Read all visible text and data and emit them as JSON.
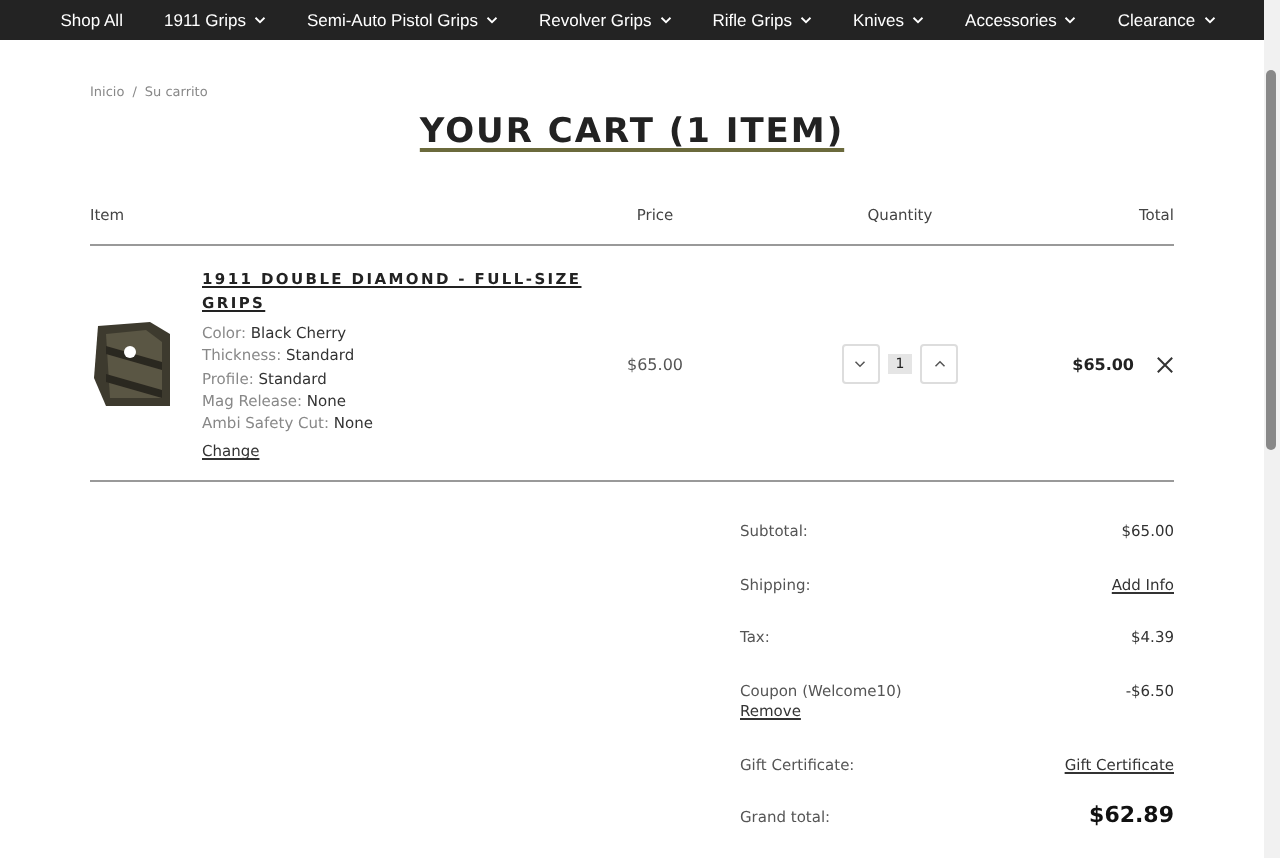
{
  "nav": [
    {
      "label": "Shop All",
      "dropdown": false
    },
    {
      "label": "1911 Grips",
      "dropdown": true
    },
    {
      "label": "Semi-Auto Pistol Grips",
      "dropdown": true
    },
    {
      "label": "Revolver Grips",
      "dropdown": true
    },
    {
      "label": "Rifle Grips",
      "dropdown": true
    },
    {
      "label": "Knives",
      "dropdown": true
    },
    {
      "label": "Accessories",
      "dropdown": true
    },
    {
      "label": "Clearance",
      "dropdown": true
    }
  ],
  "breadcrumb": {
    "separator": "/",
    "items": [
      "Inicio",
      "Su carrito"
    ]
  },
  "title": "YOUR CART (1 ITEM)",
  "columns": [
    "Item",
    "Price",
    "Quantity",
    "Total"
  ],
  "item": {
    "name": "1911 DOUBLE DIAMOND - FULL-SIZE GRIPS",
    "options": [
      {
        "label": "Color:",
        "value": "Black Cherry"
      },
      {
        "label": "Thickness:",
        "value": "Standard"
      },
      {
        "label": "Profile:",
        "value": "Standard"
      },
      {
        "label": "Mag Release:",
        "value": "None"
      },
      {
        "label": "Ambi Safety Cut:",
        "value": "None"
      }
    ],
    "change": "Change",
    "price": "$65.00",
    "quantity": "1",
    "total": "$65.00"
  },
  "totals": [
    {
      "kind": "plain",
      "label": "Subtotal:",
      "value": "$65.00"
    },
    {
      "kind": "link",
      "label": "Shipping:",
      "value": "Add Info"
    },
    {
      "kind": "plain",
      "label": "Tax:",
      "value": "$4.39"
    },
    {
      "kind": "coupon",
      "label": "Coupon (Welcome10)",
      "action": "Remove",
      "value": "-$6.50"
    },
    {
      "kind": "link",
      "label": "Gift Certificate:",
      "value": "Gift Certificate"
    },
    {
      "kind": "grand",
      "label": "Grand total:",
      "value": "$62.89"
    }
  ]
}
